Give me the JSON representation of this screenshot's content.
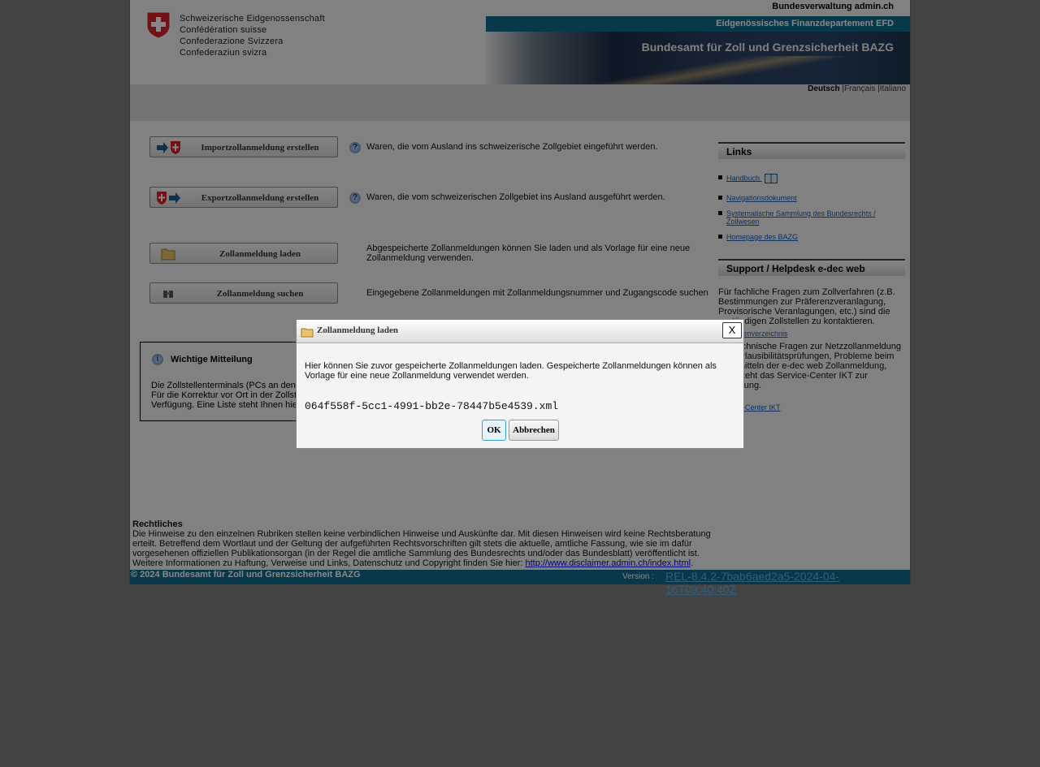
{
  "header": {
    "confederation": [
      "Schweizerische Eidgenossenschaft",
      "Confédération suisse",
      "Confederazione Svizzera",
      "Confederaziun svizra"
    ],
    "admin_link": "Bundesverwaltung admin.ch",
    "department": "Eidgenössisches Finanzdepartement EFD",
    "office": "Bundesamt für Zoll und Grenzsicherheit BAZG"
  },
  "languages": {
    "active": "Deutsch",
    "fr": "Français",
    "it": "Italiano",
    "sep": "|"
  },
  "main": {
    "actions": [
      {
        "label": "Importzollanmeldung erstellen",
        "desc": "Waren, die vom Ausland ins schweizerische Zollgebiet eingeführt werden.",
        "icon": "arrow-into-cross-icon"
      },
      {
        "label": "Exportzollanmeldung erstellen",
        "desc": "Waren, die vom schweizerischen Zollgebiet ins Ausland ausgeführt werden.",
        "icon": "cross-out-arrow-icon"
      },
      {
        "label": "Zollanmeldung laden",
        "desc": "Abgespeicherte Zollanmeldungen können Sie laden und als Vorlage für eine neue Zollanmeldung verwenden.",
        "icon": "folder-icon"
      },
      {
        "label": "Zollanmeldung suchen",
        "desc": "Eingegebene Zollanmeldungen mit Zollanmeldungsnummer und Zugangscode suchen",
        "icon": "binoculars-icon"
      }
    ],
    "help_glyph": "?",
    "notice": {
      "title": "Wichtige Mitteilung",
      "icon_glyph": "i",
      "text": "Die Zollstellenterminals (PCs an den Zollstellen) stehen nicht mehr zur Verfügung. Für die Korrektur vor Ort in der Zollstelle stehen die Terminals nicht mehr zur Verfügung. Eine Liste steht Ihnen hier zur Verfügung."
    }
  },
  "sidebar": {
    "links_title": "Links",
    "links": [
      "Handbuch",
      "Navigationsdokument",
      "Systematische Sammlung des Bundesrechts / Zollwesen",
      "Homepage des BAZG"
    ],
    "support_title": "Support / Helpdesk e-dec web",
    "support_text1": "Für fachliche Fragen zum Zollverfahren (z.B. Bestimmungen zur Präferenzveranlagung, Provisorische Veranlagungen, etc.) sind die zuständigen Zollstellen zu kontaktieren.",
    "support_link1": "Zollstellenverzeichnis",
    "support_text2": "Für technische Fragen zur Netzzollanmeldung (z.B. Plausibilitätsprüfungen, Probleme beim Übermitteln der e-dec web Zollanmeldung, etc.) steht das Service-Center IKT zur Verfügung.",
    "support_link2": "Service-Center IKT"
  },
  "footer": {
    "legal_title": "Rechtliches",
    "legal_text": "Die Hinweise zu den einzelnen Rubriken stellen keine verbindlichen Hinweise und Auskünfte dar. Mit diesen Hinweisen wird keine Rechtsberatung erteilt. Betreffend dem Wortlaut und der Geltung der aufgeführten Rechtsvorschriften gilt stets die aktuelle, amtliche Fassung, wie sie im dafür vorgesehenen offiziellen Publikationsorgan (in der Regel die amtliche Sammlung des Bundesrechts und/oder das Bundesblatt) veröffentlicht ist. Weitere Informationen zu Haftung, Verweise und Links, Datenschutz und Copyright finden Sie hier: ",
    "legal_link": "http://www.disclaimer.admin.ch/index.html",
    "legal_end": ".",
    "copyright": "© 2024 Bundesamt für Zoll und Grenzsicherheit BAZG",
    "version_label": "Version :",
    "version": "REL-8.4.2-7bab6aed2a5-2024-04-16T09:40:40Z"
  },
  "dialog": {
    "title": "Zollanmeldung laden",
    "close_label": "X",
    "text": "Hier können Sie zuvor gespeicherte Zollanmeldungen laden. Gespeicherte Zollanmeldungen können als Vorlage für eine neue Zollanmeldung verwendet werden.",
    "filename": "064f558f-5cc1-4991-bb2e-78447b5e4539.xml",
    "ok_label": "OK",
    "cancel_label": "Abbrechen"
  },
  "colors": {
    "brand_blue": "#0f6c8c",
    "swiss_red": "#d8232a",
    "overlay": "#808080"
  }
}
